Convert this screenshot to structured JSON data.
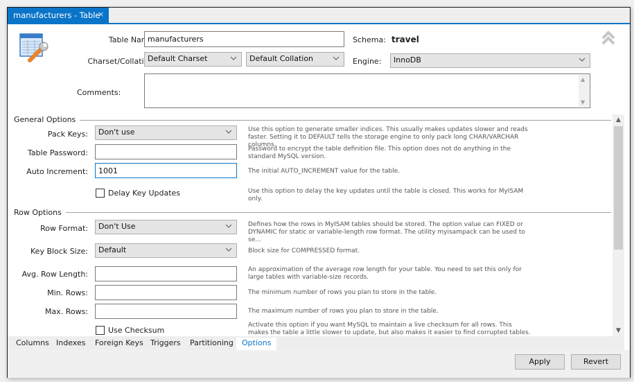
{
  "tab": {
    "title": "manufacturers - Table",
    "close_glyph": "×"
  },
  "header": {
    "table_name_label": "Table Name:",
    "table_name_value": "manufacturers",
    "schema_label": "Schema:",
    "schema_value": "travel",
    "charset_label": "Charset/Collation:",
    "charset_value": "Default Charset",
    "collation_value": "Default Collation",
    "engine_label": "Engine:",
    "engine_value": "InnoDB",
    "comments_label": "Comments:",
    "comments_value": ""
  },
  "general_options": {
    "title": "General Options",
    "pack_keys_label": "Pack Keys:",
    "pack_keys_value": "Don't use",
    "pack_keys_help": "Use this option to generate smaller indices. This usually makes updates slower and reads faster. Setting it to DEFAULT tells the storage engine to only pack long CHAR/VARCHAR columns.",
    "password_label": "Table Password:",
    "password_value": "",
    "password_help": "Password to encrypt the table definition file. This option does not do anything in the standard MySQL version.",
    "auto_increment_label": "Auto Increment:",
    "auto_increment_value": "1001",
    "auto_increment_help": "The initial AUTO_INCREMENT value for the table.",
    "delay_key_label": "Delay Key Updates",
    "delay_key_checked": false,
    "delay_key_help": "Use this option to delay the key updates until the table is closed. This works for MyISAM only."
  },
  "row_options": {
    "title": "Row Options",
    "row_format_label": "Row Format:",
    "row_format_value": "Don't Use",
    "row_format_help": "Defines how the rows in MyISAM tables should be stored. The option value can FIXED or DYNAMIC for static or variable-length row format. The utility myisampack can be used to se...",
    "key_block_label": "Key Block Size:",
    "key_block_value": "Default",
    "key_block_help": "Block size for COMPRESSED format.",
    "avg_row_label": "Avg. Row Length:",
    "avg_row_value": "",
    "avg_row_help": "An approximation of the average row length for your table. You need to set this only for large tables with variable-size records.",
    "min_rows_label": "Min. Rows:",
    "min_rows_value": "",
    "min_rows_help": "The minimum number of rows you plan to store in the table.",
    "max_rows_label": "Max. Rows:",
    "max_rows_value": "",
    "max_rows_help": "The maximum number of rows you plan to store in the table.",
    "checksum_label": "Use Checksum",
    "checksum_checked": false,
    "checksum_help": "Activate this option if you want MySQL to maintain a live checksum for all rows. This makes the table a little slower to update, but also makes it easier to find corrupted tables."
  },
  "bottom_tabs": [
    {
      "label": "Columns",
      "active": false
    },
    {
      "label": "Indexes",
      "active": false
    },
    {
      "label": "Foreign Keys",
      "active": false
    },
    {
      "label": "Triggers",
      "active": false
    },
    {
      "label": "Partitioning",
      "active": false
    },
    {
      "label": "Options",
      "active": true
    }
  ],
  "buttons": {
    "apply": "Apply",
    "revert": "Revert"
  },
  "colors": {
    "accent": "#0a74c8"
  }
}
